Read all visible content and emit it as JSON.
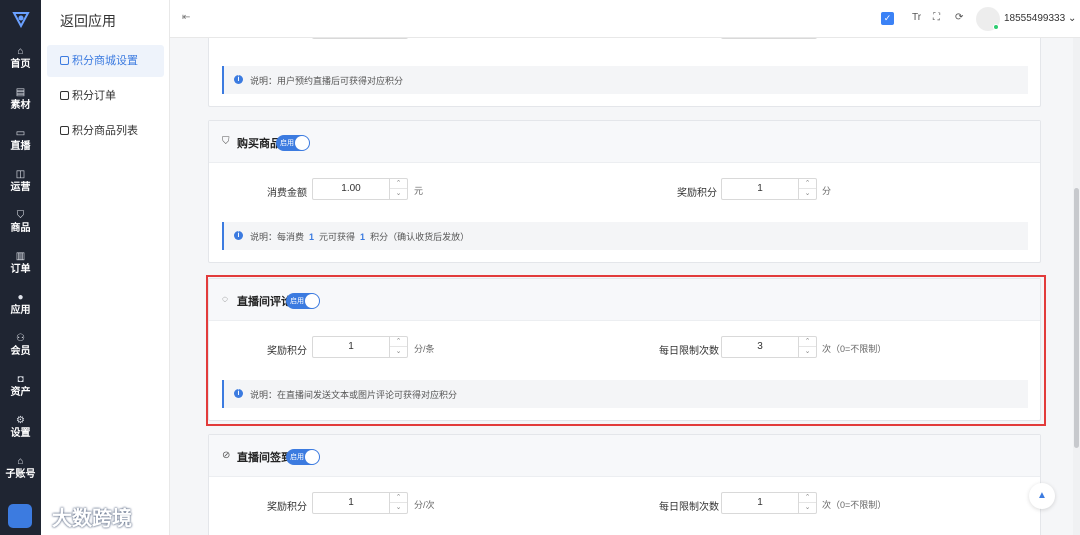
{
  "rail": {
    "items": [
      {
        "icon": "⌂",
        "label": "首页"
      },
      {
        "icon": "▤",
        "label": "素材"
      },
      {
        "icon": "▭",
        "label": "直播"
      },
      {
        "icon": "◫",
        "label": "运营"
      },
      {
        "icon": "⛉",
        "label": "商品"
      },
      {
        "icon": "▥",
        "label": "订单"
      },
      {
        "icon": "●",
        "label": "应用"
      },
      {
        "icon": "⚇",
        "label": "会员"
      },
      {
        "icon": "◘",
        "label": "资产"
      },
      {
        "icon": "⚙",
        "label": "设置"
      },
      {
        "icon": "⌂",
        "label": "子账号"
      }
    ]
  },
  "subnav": {
    "back": "返回应用",
    "items": [
      {
        "label": "积分商城设置",
        "active": true
      },
      {
        "label": "积分订单",
        "active": false
      },
      {
        "label": "积分商品列表",
        "active": false
      }
    ]
  },
  "topbar": {
    "username": "18555499333",
    "dropdown_glyph": "⌄",
    "collapse_glyph": "⇤",
    "check_glyph": "✓",
    "font_glyph": "Tr",
    "fullscreen_glyph": "⛶",
    "refresh_glyph": "⟳"
  },
  "cards": {
    "reserve": {
      "note": "说明：用户预约直播后可获得对应积分"
    },
    "purchase": {
      "title": "购买商品",
      "icon": "cart-icon",
      "toggle": "启用",
      "label_left": "消费金额",
      "value_left": "1.00",
      "unit_left": "元",
      "label_right": "奖励积分",
      "value_right": "1",
      "unit_right": "分",
      "note_a": "说明：每消费",
      "note_n1": "1",
      "note_b": "元可获得",
      "note_n2": "1",
      "note_c": "积分（确认收货后发放）"
    },
    "comment": {
      "title": "直播间评论",
      "icon": "comment-icon",
      "toggle": "启用",
      "label_left": "奖励积分",
      "value_left": "1",
      "unit_left": "分/条",
      "label_right": "每日限制次数",
      "value_right": "3",
      "unit_right": "次（0=不限制）",
      "note": "说明：在直播间发送文本或图片评论可获得对应积分"
    },
    "checkin": {
      "title": "直播间签到",
      "icon": "check-circle-icon",
      "toggle": "启用",
      "label_left": "奖励积分",
      "value_left": "1",
      "unit_left": "分/次",
      "label_right": "每日限制次数",
      "value_right": "1",
      "unit_right": "次（0=不限制）"
    }
  },
  "stepper": {
    "up": "⌃",
    "down": "⌄"
  },
  "info_glyph": "i",
  "back_top_glyph": "▲",
  "watermark": "大数跨境",
  "colors": {
    "accent": "#3c7be0",
    "rail": "#1f2532",
    "highlight": "#e23b3b"
  }
}
